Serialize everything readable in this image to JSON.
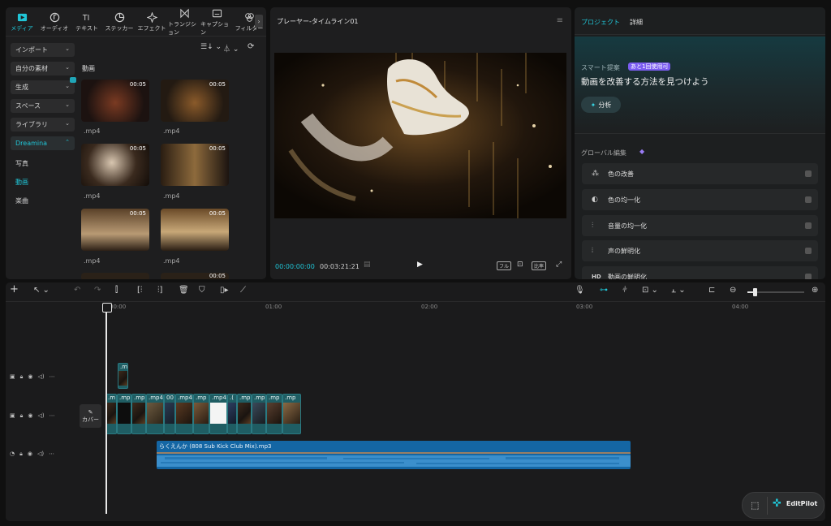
{
  "media_toolbar": {
    "items": [
      {
        "label": "メディア",
        "icon": "media-icon"
      },
      {
        "label": "オーディオ",
        "icon": "audio-icon"
      },
      {
        "label": "テキスト",
        "icon": "text-icon"
      },
      {
        "label": "ステッカー",
        "icon": "sticker-icon"
      },
      {
        "label": "エフェクト",
        "icon": "effect-icon"
      },
      {
        "label": "トランジション",
        "icon": "transition-icon"
      },
      {
        "label": "キャプション",
        "icon": "caption-icon"
      },
      {
        "label": "フィルター",
        "icon": "filter-icon"
      }
    ]
  },
  "sidebar": {
    "import": "インポート",
    "my_assets": "自分の素材",
    "generate": "生成",
    "space": "スペース",
    "library": "ライブラリ",
    "dreamina": "Dreamina",
    "sub_photo": "写真",
    "sub_video": "動画",
    "sub_music": "楽曲"
  },
  "media_grid": {
    "section_title": "動画",
    "items": [
      {
        "duration": "00:05",
        "label": ".mp4"
      },
      {
        "duration": "00:05",
        "label": ".mp4"
      },
      {
        "duration": "00:05",
        "label": ".mp4"
      },
      {
        "duration": "00:05",
        "label": ".mp4"
      },
      {
        "duration": "00:05",
        "label": ".mp4"
      },
      {
        "duration": "00:05",
        "label": ".mp4"
      }
    ],
    "partial_duration": "00:05"
  },
  "player": {
    "title": "プレーヤー-タイムライン01",
    "current_time": "00:00:00:00",
    "total_time": "00:03:21:21",
    "ratio_label": "比率"
  },
  "right_panel": {
    "tab_project": "プロジェクト",
    "tab_details": "詳細",
    "smart_label": "スマート提案",
    "badge": "あと1回使用可",
    "headline": "動画を改善する方法を見つけよう",
    "analyze_button": "分析",
    "global_edit": "グローバル編集",
    "items": [
      {
        "label": "色の改善",
        "icon": "color-wand-icon"
      },
      {
        "label": "色の均一化",
        "icon": "color-match-icon"
      },
      {
        "label": "音量の均一化",
        "icon": "volume-eq-icon"
      },
      {
        "label": "声の鮮明化",
        "icon": "voice-icon"
      },
      {
        "label": "動画の鮮明化",
        "icon": "hd-icon"
      }
    ]
  },
  "timeline": {
    "ruler": [
      "00:00",
      "01:00",
      "02:00",
      "03:00",
      "04:00"
    ],
    "cover_label": "カバー",
    "overlay_clip_label": ".m",
    "main_clips": [
      ".m",
      ".mp",
      ".mp",
      ".mp4",
      "00",
      ".mp4",
      ".mp",
      ".mp4",
      ".(",
      ".mp",
      ".mp",
      ".mp",
      ".mp"
    ],
    "audio_label": "らくえんか (808 Sub Kick Club Mix).mp3"
  },
  "editpilot": {
    "label": "EditPilot"
  },
  "colors": {
    "accent": "#20c5d6",
    "audio": "#1466a4",
    "clip": "#1f5d63",
    "badge": "#7b5cf0"
  }
}
